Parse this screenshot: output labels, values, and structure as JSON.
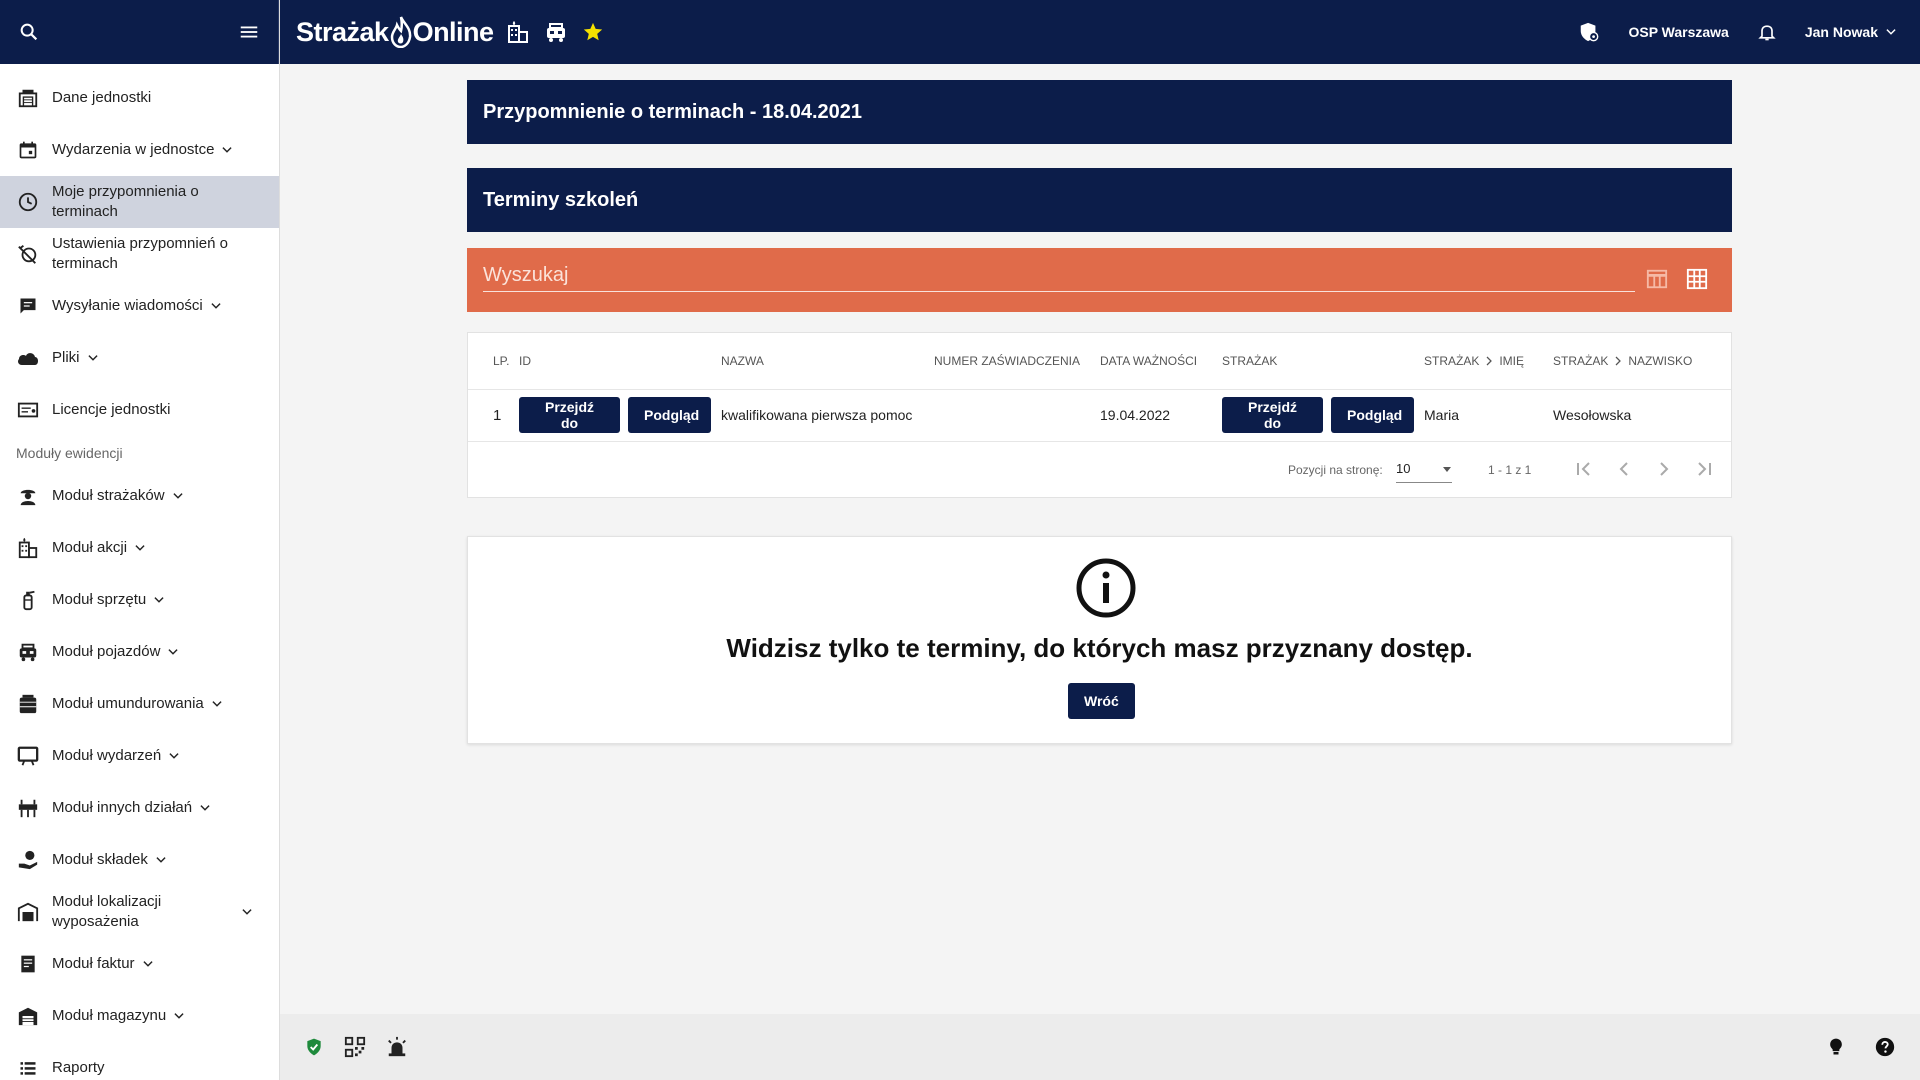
{
  "app": {
    "brand_left": "Strażak",
    "brand_right": "Online",
    "unit_name": "OSP Warszawa",
    "user_name": "Jan Nowak"
  },
  "sidebar": {
    "items": [
      {
        "label": "Dane jednostki",
        "icon": "fire-station-icon",
        "chevron": false
      },
      {
        "label": "Wydarzenia w jednostce",
        "icon": "calendar-icon",
        "chevron": true
      },
      {
        "label": "Moje przypomnienia o terminach",
        "icon": "clock-icon",
        "chevron": false,
        "active": true
      },
      {
        "label": "Ustawienia przypomnień o terminach",
        "icon": "alarm-off-icon",
        "chevron": false
      },
      {
        "label": "Wysyłanie wiadomości",
        "icon": "message-icon",
        "chevron": true
      },
      {
        "label": "Pliki",
        "icon": "cloud-icon",
        "chevron": true
      },
      {
        "label": "Licencje jednostki",
        "icon": "license-icon",
        "chevron": false
      }
    ],
    "section_label": "Moduły ewidencji",
    "modules": [
      {
        "label": "Moduł strażaków",
        "icon": "firefighter-icon"
      },
      {
        "label": "Moduł akcji",
        "icon": "building-fire-icon"
      },
      {
        "label": "Moduł sprzętu",
        "icon": "extinguisher-icon"
      },
      {
        "label": "Moduł pojazdów",
        "icon": "fire-truck-icon"
      },
      {
        "label": "Moduł umundurowania",
        "icon": "uniform-icon"
      },
      {
        "label": "Moduł wydarzeń",
        "icon": "presentation-icon"
      },
      {
        "label": "Moduł innych działań",
        "icon": "other-actions-icon"
      },
      {
        "label": "Moduł składek",
        "icon": "fees-icon"
      },
      {
        "label": "Moduł lokalizacji wyposażenia",
        "icon": "warehouse-icon"
      },
      {
        "label": "Moduł faktur",
        "icon": "invoice-icon"
      },
      {
        "label": "Moduł magazynu",
        "icon": "storage-icon"
      },
      {
        "label": "Raporty",
        "icon": "list-icon"
      }
    ]
  },
  "main": {
    "reminder_title": "Przypomnienie o terminach - 18.04.2021",
    "section_title": "Terminy szkoleń",
    "search_placeholder": "Wyszukaj",
    "table": {
      "headers": {
        "lp": "LP.",
        "id": "ID",
        "name": "NAZWA",
        "cert": "NUMER ZAŚWIADCZENIA",
        "validity": "DATA WAŻNOŚCI",
        "firefighter": "STRAŻAK",
        "ff_first": "STRAŻAK",
        "first_name": "IMIĘ",
        "ff_last": "STRAŻAK",
        "last_name": "NAZWISKO"
      },
      "rows": [
        {
          "lp": "1",
          "goto_label": "Przejdź do",
          "preview_label": "Podgląd",
          "name": "kwalifikowana pierwsza pomoc",
          "cert": "",
          "validity": "19.04.2022",
          "first_name": "Maria",
          "last_name": "Wesołowska"
        }
      ]
    },
    "paginator": {
      "per_page_label": "Pozycji na stronę:",
      "per_page_value": "10",
      "range_label": "1 - 1 z 1"
    },
    "info": {
      "message": "Widzisz tylko te terminy, do których masz przyznany dostęp.",
      "back_label": "Wróć"
    }
  },
  "colors": {
    "navy": "#0c1d4a",
    "search_orange": "#e06b4a",
    "active_item": "#cfd3de"
  }
}
